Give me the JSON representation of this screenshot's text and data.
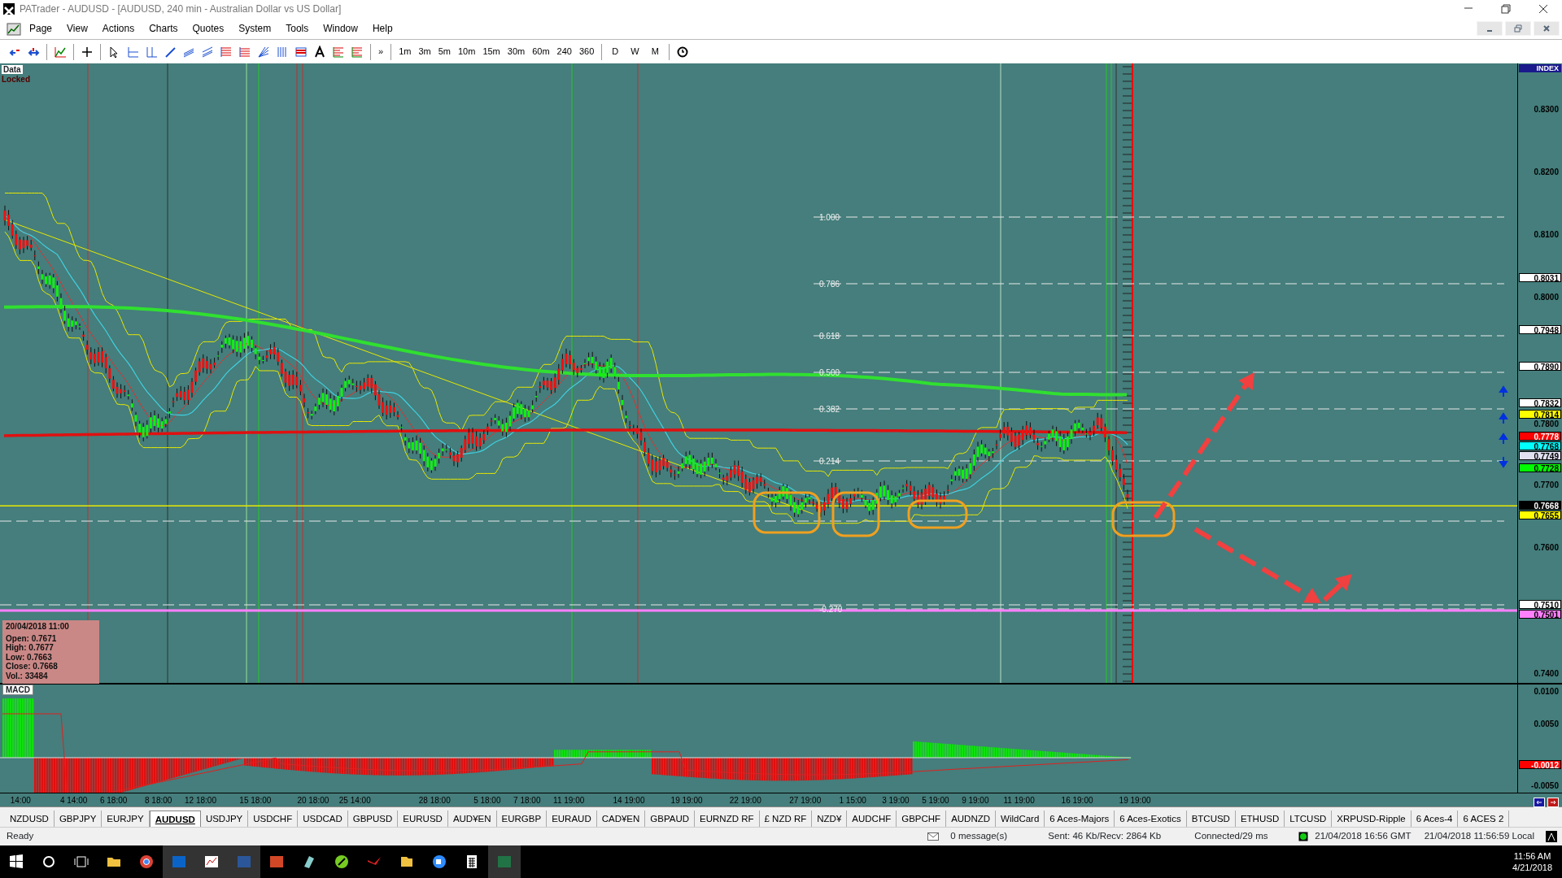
{
  "window": {
    "title": "PATrader - AUDUSD - [AUDUSD, 240 min - Australian Dollar vs US Dollar]"
  },
  "menu": [
    "Page",
    "View",
    "Actions",
    "Charts",
    "Quotes",
    "System",
    "Tools",
    "Window",
    "Help"
  ],
  "toolbar": {
    "more": "»",
    "timeframes": [
      "1m",
      "3m",
      "5m",
      "10m",
      "15m",
      "30m",
      "60m",
      "240",
      "360"
    ],
    "periods": [
      "D",
      "W",
      "M"
    ]
  },
  "chart": {
    "data_label": "Data",
    "lock_label": "Locked",
    "index_label": "INDEX",
    "fib_levels": [
      "1.000",
      "0.786",
      "0.618",
      "0.500",
      "0.382",
      "0.214",
      "-0.270"
    ],
    "price_ticks": [
      "0.8300",
      "0.8200",
      "0.8100",
      "0.8000",
      "0.7800",
      "0.7700",
      "0.7600",
      "0.7400"
    ],
    "price_markers": [
      {
        "text": "0.8031",
        "color": "#ffffff"
      },
      {
        "text": "0.7948",
        "color": "#ffffff"
      },
      {
        "text": "0.7890",
        "color": "#ffffff"
      },
      {
        "text": "0.7832",
        "color": "#ffffff"
      },
      {
        "text": "0.7814",
        "color": "#ffff00"
      },
      {
        "text": "0.7778",
        "color": "#ff0000"
      },
      {
        "text": "0.7768",
        "color": "#00ffff"
      },
      {
        "text": "0.7749",
        "color": "#e0e0f0"
      },
      {
        "text": "0.7728",
        "color": "#00ff00"
      },
      {
        "text": "0.7668",
        "color": "#000000"
      },
      {
        "text": "0.7655",
        "color": "#ffff00"
      },
      {
        "text": "0.7510",
        "color": "#ffffff"
      },
      {
        "text": "0.7501",
        "color": "#ff80ff"
      }
    ],
    "info_box": {
      "title": "20/04/2018 11:00",
      "lines": [
        "Open: 0.7671",
        "High: 0.7677",
        "Low: 0.7663",
        "Close: 0.7668",
        "Vol.: 33484"
      ]
    },
    "x_labels": [
      "14:00",
      "4 14:00",
      "6 18:00",
      "8 18:00",
      "12 18:00",
      "15 18:00",
      "20 18:00",
      "25 14:00",
      "28 18:00",
      "5 18:00",
      "7 18:00",
      "11 19:00",
      "14 19:00",
      "19 19:00",
      "22 19:00",
      "27 19:00",
      "1 15:00",
      "3 19:00",
      "5 19:00",
      "9 19:00",
      "11 19:00",
      "16 19:00",
      "19 19:00"
    ]
  },
  "macd": {
    "label": "MACD",
    "ticks": [
      "0.0100",
      "0.0050",
      "-0.0050"
    ],
    "markers": [
      {
        "text": "-0.0012",
        "color": "#ff0000"
      }
    ]
  },
  "tabs": [
    {
      "label": "NZDUSD",
      "selected": false
    },
    {
      "label": "GBPJPY",
      "selected": false
    },
    {
      "label": "EURJPY",
      "selected": false
    },
    {
      "label": "AUDUSD",
      "selected": true
    },
    {
      "label": "USDJPY",
      "selected": false
    },
    {
      "label": "USDCHF",
      "selected": false
    },
    {
      "label": "USDCAD",
      "selected": false
    },
    {
      "label": "GBPUSD",
      "selected": false
    },
    {
      "label": "EURUSD",
      "selected": false
    },
    {
      "label": "AUD¥EN",
      "selected": false
    },
    {
      "label": "EURGBP",
      "selected": false
    },
    {
      "label": "EURAUD",
      "selected": false
    },
    {
      "label": "CAD¥EN",
      "selected": false
    },
    {
      "label": "GBPAUD",
      "selected": false
    },
    {
      "label": "EURNZD RF",
      "selected": false
    },
    {
      "label": "£ NZD RF",
      "selected": false
    },
    {
      "label": "NZD¥",
      "selected": false
    },
    {
      "label": "AUDCHF",
      "selected": false
    },
    {
      "label": "GBPCHF",
      "selected": false
    },
    {
      "label": "AUDNZD",
      "selected": false
    },
    {
      "label": "WildCard",
      "selected": false
    },
    {
      "label": "6 Aces-Majors",
      "selected": false
    },
    {
      "label": "6 Aces-Exotics",
      "selected": false
    },
    {
      "label": "BTCUSD",
      "selected": false
    },
    {
      "label": "ETHUSD",
      "selected": false
    },
    {
      "label": "LTCUSD",
      "selected": false
    },
    {
      "label": "XRPUSD-Ripple",
      "selected": false
    },
    {
      "label": "6 Aces-4",
      "selected": false
    },
    {
      "label": "6 ACES 2",
      "selected": false
    }
  ],
  "status_bar": {
    "ready": "Ready",
    "messages": "0 message(s)",
    "traffic": "Sent: 46 Kb/Recv: 2864 Kb",
    "connection": "Connected/29 ms",
    "gmt": "21/04/2018 16:56 GMT",
    "local": "21/04/2018 11:56:59 Local"
  },
  "taskbar": {
    "time": "11:56 AM",
    "date": "4/21/2018"
  }
}
